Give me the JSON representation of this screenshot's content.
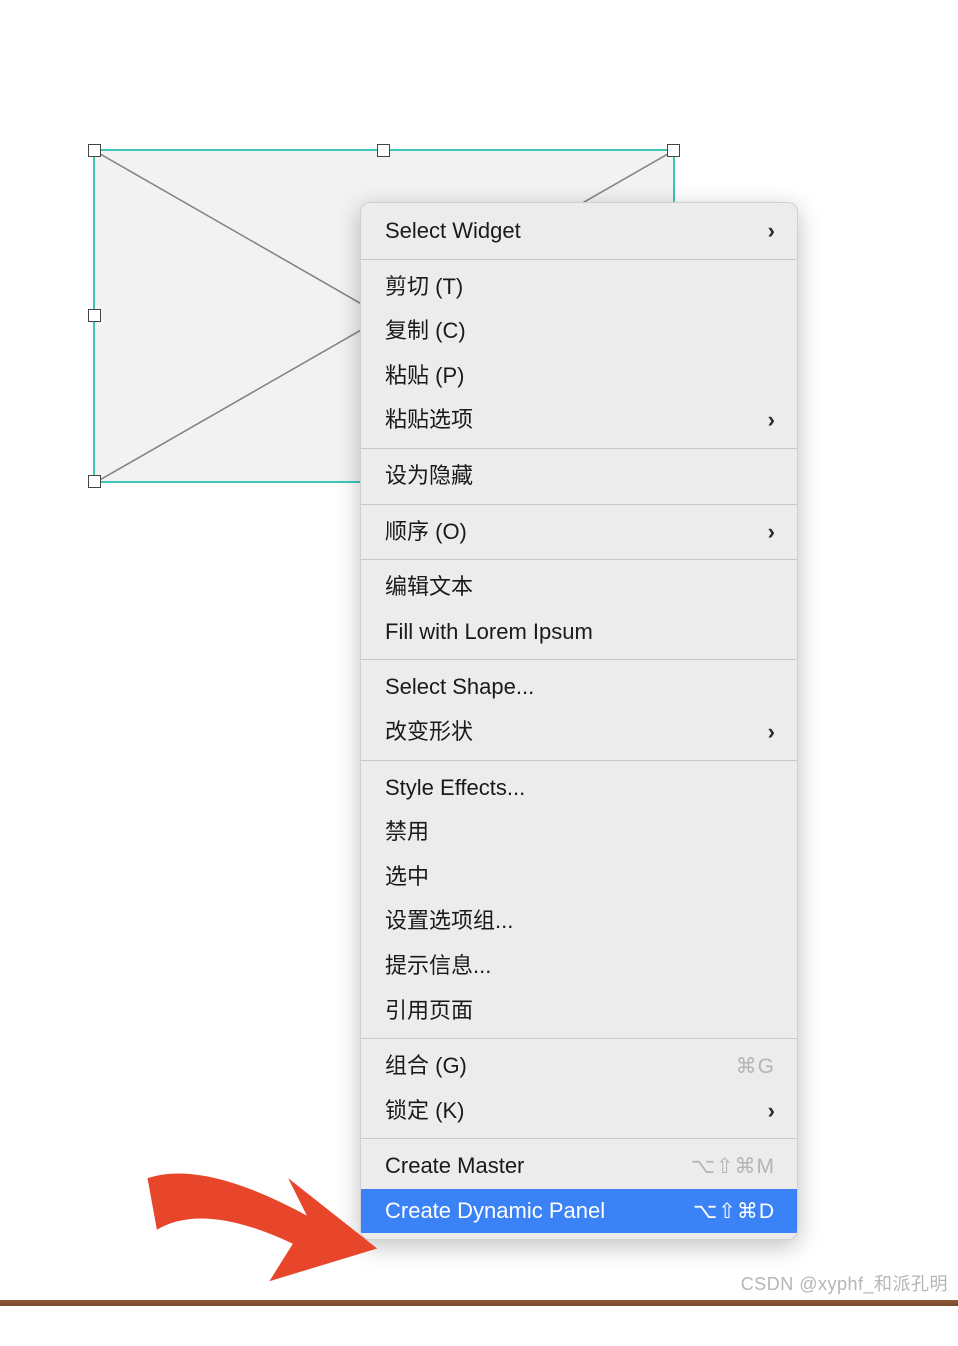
{
  "menu": {
    "select_widget": "Select Widget",
    "cut": "剪切 (T)",
    "copy": "复制 (C)",
    "paste": "粘贴 (P)",
    "paste_options": "粘贴选项",
    "set_hidden": "设为隐藏",
    "order": "顺序 (O)",
    "edit_text": "编辑文本",
    "fill_lorem": "Fill with Lorem Ipsum",
    "select_shape": "Select Shape...",
    "change_shape": "改变形状",
    "style_effects": "Style Effects...",
    "disable": "禁用",
    "selected": "选中",
    "set_option_group": "设置选项组...",
    "tooltip": "提示信息...",
    "reference_page": "引用页面",
    "group": "组合 (G)",
    "group_shortcut": "⌘G",
    "lock": "锁定 (K)",
    "create_master": "Create Master",
    "create_master_shortcut": "⌥⇧⌘M",
    "create_dynamic_panel": "Create Dynamic Panel",
    "create_dynamic_panel_shortcut": "⌥⇧⌘D"
  },
  "watermark": "CSDN @xyphf_和派孔明"
}
